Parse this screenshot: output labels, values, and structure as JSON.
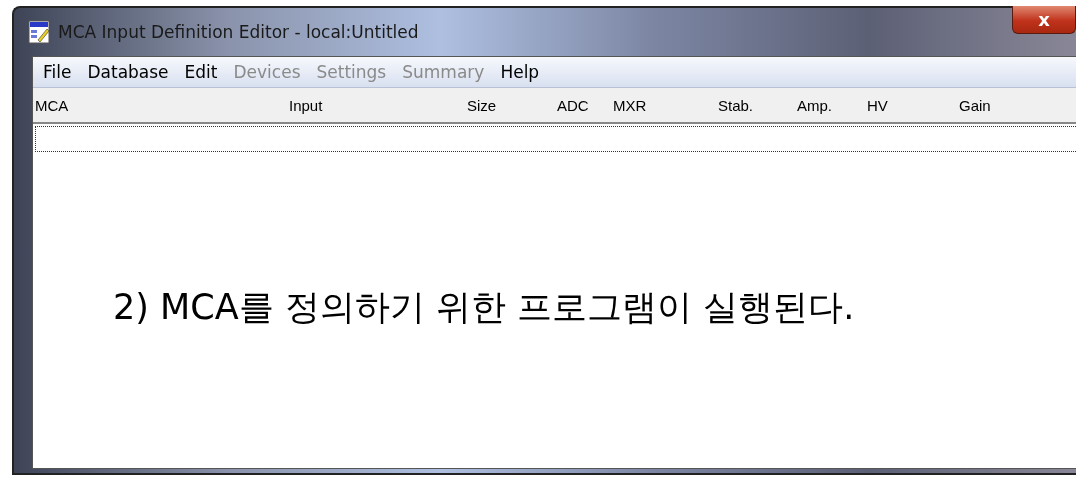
{
  "window": {
    "title": "MCA Input Definition Editor - local:Untitled",
    "close": "x"
  },
  "menu": [
    {
      "label": "File",
      "disabled": false
    },
    {
      "label": "Database",
      "disabled": false
    },
    {
      "label": "Edit",
      "disabled": false
    },
    {
      "label": "Devices",
      "disabled": true
    },
    {
      "label": "Settings",
      "disabled": true
    },
    {
      "label": "Summary",
      "disabled": true
    },
    {
      "label": "Help",
      "disabled": false
    }
  ],
  "columns": [
    "MCA",
    "Input",
    "Size",
    "ADC",
    "MXR",
    "Stab.",
    "Amp.",
    "HV",
    "Gain"
  ],
  "annotation": "2) MCA를 정의하기 위한 프로그램이 실행된다."
}
